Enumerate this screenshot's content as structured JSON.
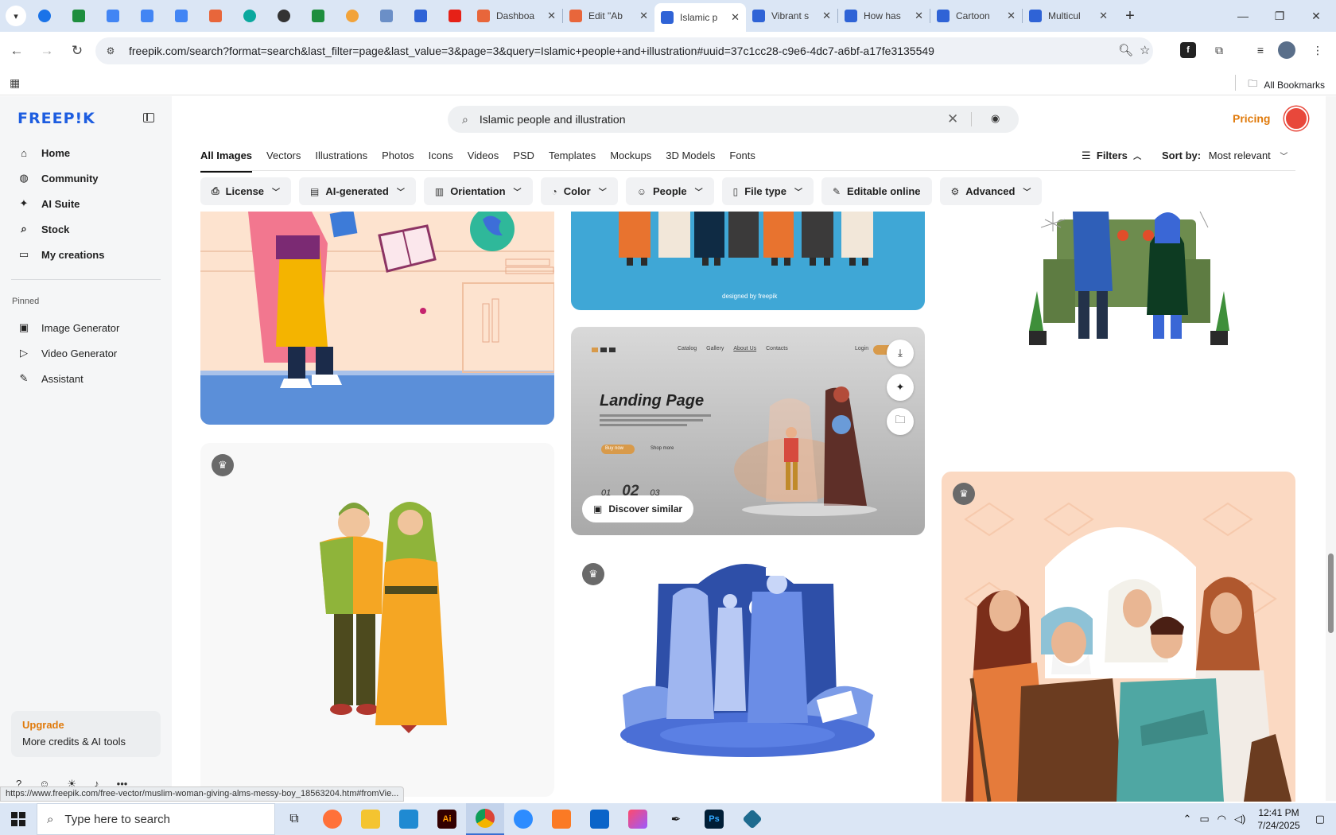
{
  "browser": {
    "tabs": [
      {
        "title": "Dashboa",
        "favicon_color": "#e8663b"
      },
      {
        "title": "Edit \"Ab",
        "favicon_color": "#e8663b"
      },
      {
        "title": "Islamic p",
        "favicon_color": "#2f63d6",
        "active": true
      },
      {
        "title": "Vibrant s",
        "favicon_color": "#2f63d6"
      },
      {
        "title": "How has",
        "favicon_color": "#2f63d6"
      },
      {
        "title": "Cartoon",
        "favicon_color": "#2f63d6"
      },
      {
        "title": "Multicul",
        "favicon_color": "#2f63d6"
      }
    ],
    "url": "freepik.com/search?format=search&last_filter=page&last_value=3&page=3&query=Islamic+people+and+illustration#uuid=37c1cc28-c9e6-4dc7-a6bf-a17fe3135549",
    "bookmarks_label": "All Bookmarks",
    "status_url": "https://www.freepik.com/free-vector/muslim-woman-giving-alms-messy-boy_18563204.htm#fromVie..."
  },
  "sidebar": {
    "logo": "FREEP!K",
    "nav": [
      {
        "label": "Home",
        "icon": "home-icon"
      },
      {
        "label": "Community",
        "icon": "globe-icon"
      },
      {
        "label": "AI Suite",
        "icon": "sparkle-icon"
      },
      {
        "label": "Stock",
        "icon": "search-icon"
      },
      {
        "label": "My creations",
        "icon": "folder-icon"
      }
    ],
    "pinned_label": "Pinned",
    "pinned": [
      {
        "label": "Image Generator",
        "icon": "image-icon"
      },
      {
        "label": "Video Generator",
        "icon": "video-icon"
      },
      {
        "label": "Assistant",
        "icon": "assistant-icon"
      }
    ],
    "upgrade": {
      "title": "Upgrade",
      "subtitle": "More credits & AI tools"
    }
  },
  "header": {
    "search_query": "Islamic people and illustration",
    "pricing": "Pricing",
    "categories": [
      "All Images",
      "Vectors",
      "Illustrations",
      "Photos",
      "Icons",
      "Videos",
      "PSD",
      "Templates",
      "Mockups",
      "3D Models",
      "Fonts"
    ],
    "active_category": "All Images",
    "filters_label": "Filters",
    "sort_label": "Sort by:",
    "sort_value": "Most relevant",
    "chips": [
      "License",
      "AI-generated",
      "Orientation",
      "Color",
      "People",
      "File type",
      "Editable online",
      "Advanced"
    ]
  },
  "results": {
    "landing_page_card": {
      "title": "Landing Page",
      "nav": [
        "Catalog",
        "Gallery",
        "About Us",
        "Contacts"
      ],
      "login": "Login",
      "pages": [
        "01",
        "02",
        "03"
      ],
      "cta": "Buy now",
      "cta2": "Shop more",
      "discover": "Discover similar"
    },
    "watermark": "designed by freepik"
  },
  "taskbar": {
    "search_placeholder": "Type here to search",
    "time": "12:41 PM",
    "date": "7/24/2025"
  },
  "colors": {
    "brand_blue": "#1d5de0",
    "accent_orange": "#e07a0b"
  }
}
